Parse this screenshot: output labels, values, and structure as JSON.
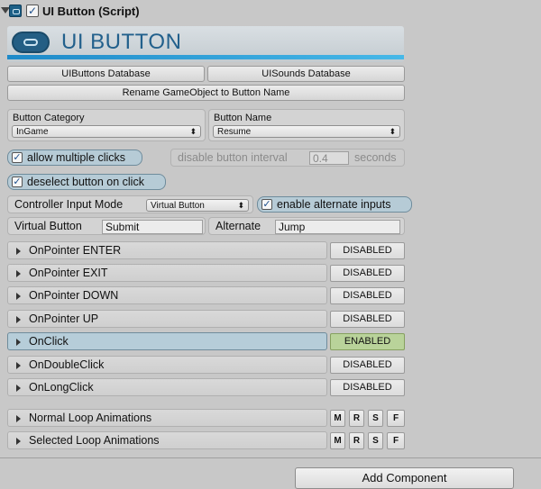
{
  "component": {
    "title": "UI Button (Script)",
    "enabled": true
  },
  "banner": {
    "title": "UI BUTTON",
    "accent_color": "#1e8ac9"
  },
  "toolbar": {
    "buttons_db_label": "UIButtons Database",
    "sounds_db_label": "UISounds Database",
    "rename_label": "Rename GameObject to Button Name"
  },
  "category": {
    "label": "Button Category",
    "value": "InGame"
  },
  "button_name": {
    "label": "Button Name",
    "value": "Resume"
  },
  "options": {
    "allow_multiple_clicks": {
      "label": "allow multiple clicks",
      "checked": true
    },
    "disable_interval": {
      "label": "disable button interval",
      "value": "0.4",
      "unit": "seconds"
    },
    "deselect_on_click": {
      "label": "deselect button on click",
      "checked": true
    }
  },
  "controller": {
    "label": "Controller Input Mode",
    "mode": "Virtual Button",
    "enable_alternate": {
      "label": "enable alternate inputs",
      "checked": true
    },
    "virtual_button_label": "Virtual Button",
    "virtual_button_value": "Submit",
    "alternate_label": "Alternate",
    "alternate_value": "Jump"
  },
  "events": [
    {
      "label": "OnPointer ENTER",
      "status": "DISABLED"
    },
    {
      "label": "OnPointer EXIT",
      "status": "DISABLED"
    },
    {
      "label": "OnPointer DOWN",
      "status": "DISABLED"
    },
    {
      "label": "OnPointer UP",
      "status": "DISABLED"
    },
    {
      "label": "OnClick",
      "status": "ENABLED"
    },
    {
      "label": "OnDoubleClick",
      "status": "DISABLED"
    },
    {
      "label": "OnLongClick",
      "status": "DISABLED"
    }
  ],
  "animations": [
    {
      "label": "Normal Loop Animations",
      "buttons": [
        "M",
        "R",
        "S",
        "F"
      ]
    },
    {
      "label": "Selected Loop Animations",
      "buttons": [
        "M",
        "R",
        "S",
        "F"
      ]
    }
  ],
  "footer": {
    "add_component_label": "Add Component"
  },
  "colors": {
    "enabled_badge": "#b9d39a",
    "active_row": "#b6cdd9",
    "panel": "#c8c8c8"
  }
}
